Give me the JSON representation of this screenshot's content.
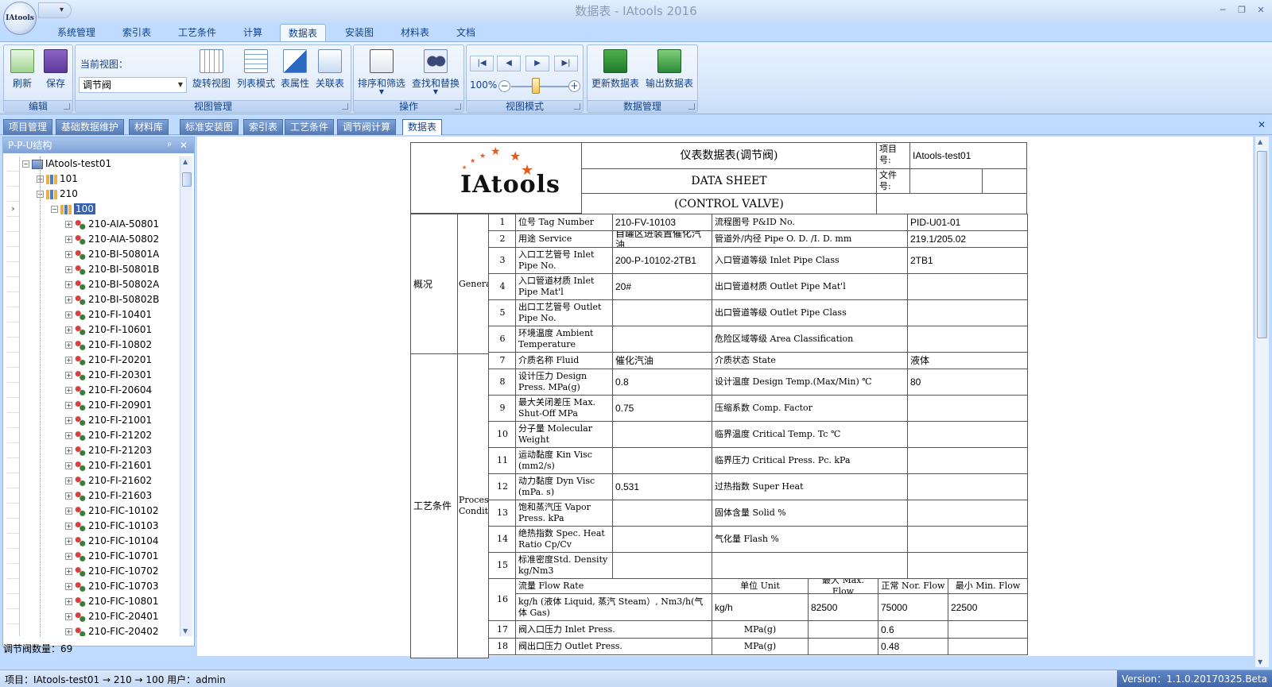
{
  "window": {
    "app_title": "数据表 - IAtools 2016",
    "logo_text": "IAtools"
  },
  "ribbon_tabs": [
    "系统管理",
    "索引表",
    "工艺条件",
    "计算",
    "数据表",
    "安装图",
    "材料表",
    "文档"
  ],
  "ribbon": {
    "edit": {
      "title": "编辑",
      "refresh": "刷新",
      "save": "保存"
    },
    "view_mgmt": {
      "title": "视图管理",
      "current_view_label": "当前视图：",
      "current_view_value": "调节阀",
      "rotate": "旋转视图",
      "list_mode": "列表模式",
      "table_props": "表属性",
      "link_table": "关联表"
    },
    "operations": {
      "title": "操作",
      "sort_filter": "排序和筛选",
      "find_replace": "查找和替换"
    },
    "view_mode": {
      "title": "视图模式",
      "zoom": "100%"
    },
    "data_mgmt": {
      "title": "数据管理",
      "update": "更新数据表",
      "export": "输出数据表"
    }
  },
  "doc_tabs": [
    "项目管理",
    "基础数据维护",
    "材料库",
    "标准安装图",
    "索引表",
    "工艺条件",
    "调节阀计算",
    "数据表"
  ],
  "tree": {
    "title": "P-P-U结构",
    "root": "IAtools-test01",
    "nodes": [
      "101",
      "210",
      "100"
    ],
    "items": [
      "210-AIA-50801",
      "210-AIA-50802",
      "210-BI-50801A",
      "210-BI-50801B",
      "210-BI-50802A",
      "210-BI-50802B",
      "210-FI-10401",
      "210-FI-10601",
      "210-FI-10802",
      "210-FI-20201",
      "210-FI-20301",
      "210-FI-20604",
      "210-FI-20901",
      "210-FI-21001",
      "210-FI-21202",
      "210-FI-21203",
      "210-FI-21601",
      "210-FI-21602",
      "210-FI-21603",
      "210-FIC-10102",
      "210-FIC-10103",
      "210-FIC-10104",
      "210-FIC-10701",
      "210-FIC-10702",
      "210-FIC-10703",
      "210-FIC-10801",
      "210-FIC-20401",
      "210-FIC-20402"
    ],
    "count_label": "调节阀数量：69"
  },
  "sheet": {
    "title_cn": "仪表数据表(调节阀)",
    "title_en": "DATA SHEET",
    "title_en2": "(CONTROL VALVE)",
    "project_no_label": "项目号:",
    "project_no": "IAtools-test01",
    "file_no_label": "文件号:",
    "section1_cn": "概况",
    "section1_en": "General",
    "section2_cn": "工艺条件",
    "section2_en": "Process Conditions",
    "rows": [
      {
        "n": "1",
        "l1": "位号 Tag Number",
        "v1": "210-FV-10103",
        "l2": "流程图号 P&ID No.",
        "v2": "PID-U01-01"
      },
      {
        "n": "2",
        "l1": "用途 Service",
        "v1": "自罐区进装置催化汽油",
        "l2": "管道外/内径 Pipe O. D. /I. D. mm",
        "v2": "219.1/205.02"
      },
      {
        "n": "3",
        "l1": "入口工艺管号 Inlet Pipe No.",
        "v1": "200-P-10102-2TB1",
        "l2": "入口管道等级 Inlet Pipe Class",
        "v2": "2TB1"
      },
      {
        "n": "4",
        "l1": "入口管道材质 Inlet Pipe Mat'l",
        "v1": "20#",
        "l2": "出口管道材质 Outlet Pipe Mat'l",
        "v2": ""
      },
      {
        "n": "5",
        "l1": "出口工艺管号 Outlet Pipe No.",
        "v1": "",
        "l2": "出口管道等级 Outlet Pipe Class",
        "v2": ""
      },
      {
        "n": "6",
        "l1": "环境温度 Ambient Temperature",
        "v1": "",
        "l2": "危险区域等级 Area Classification",
        "v2": ""
      },
      {
        "n": "7",
        "l1": "介质名称 Fluid",
        "v1": "催化汽油",
        "l2": "介质状态 State",
        "v2": "液体"
      },
      {
        "n": "8",
        "l1": "设计压力 Design Press. MPa(g)",
        "v1": "0.8",
        "l2": "设计温度 Design Temp.(Max/Min) ℃",
        "v2": "80"
      },
      {
        "n": "9",
        "l1": "最大关闭差压 Max. Shut-Off MPa",
        "v1": "0.75",
        "l2": "压缩系数 Comp. Factor",
        "v2": ""
      },
      {
        "n": "10",
        "l1": "分子量 Molecular Weight",
        "v1": "",
        "l2": "临界温度 Critical Temp. Tc ℃",
        "v2": ""
      },
      {
        "n": "11",
        "l1": "运动黏度 Kin Visc (mm2/s)",
        "v1": "",
        "l2": "临界压力 Critical Press. Pc. kPa",
        "v2": ""
      },
      {
        "n": "12",
        "l1": "动力黏度 Dyn Visc (mPa. s)",
        "v1": "0.531",
        "l2": "过热指数 Super Heat",
        "v2": ""
      },
      {
        "n": "13",
        "l1": "饱和蒸汽压 Vapor Press. kPa",
        "v1": "",
        "l2": "固体含量 Solid %",
        "v2": ""
      },
      {
        "n": "14",
        "l1": "绝热指数 Spec. Heat Ratio Cp/Cv",
        "v1": "",
        "l2": "气化量 Flash %",
        "v2": ""
      },
      {
        "n": "15",
        "l1": "标准密度Std. Density kg/Nm3",
        "v1": "",
        "l2": "",
        "v2": ""
      }
    ],
    "flow": {
      "n": "16",
      "label": "流量 Flow Rate",
      "unit_label": "单位 Unit",
      "max_label": "最大 Max. Flow",
      "nor_label": "正常 Nor. Flow",
      "min_label": "最小 Min. Flow",
      "sub_label": "kg/h (液体 Liquid, 蒸汽 Steam）, Nm3/h(气体 Gas)",
      "unit": "kg/h",
      "max": "82500",
      "nor": "75000",
      "min": "22500"
    },
    "row17": {
      "n": "17",
      "label": "阀入口压力 Inlet Press.",
      "unit": "MPa(g)",
      "nor": "0.6"
    },
    "row18": {
      "n": "18",
      "label": "阀出口压力 Outlet Press.",
      "unit": "MPa(g)",
      "nor": "0.48"
    }
  },
  "status": {
    "text": "项目：IAtools-test01 → 210 → 100 用户：admin",
    "version": "Version：1.1.0.20170325.Beta"
  }
}
